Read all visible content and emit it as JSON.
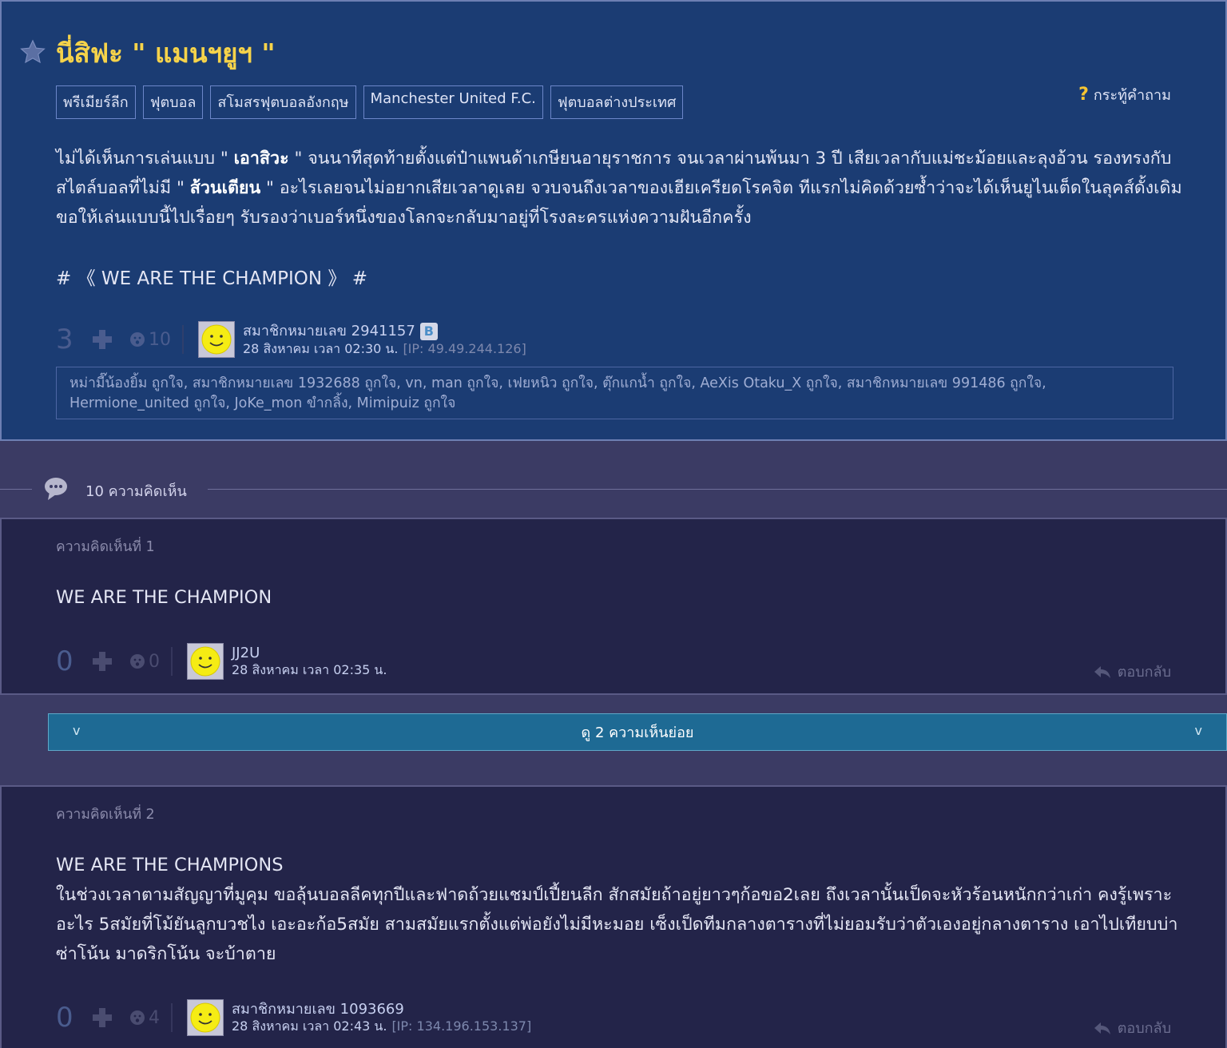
{
  "topic": {
    "title": "นี่สิฟะ \" แมนฯยูฯ \"",
    "tags": [
      "พรีเมียร์ลีก",
      "ฟุตบอล",
      "สโมสรฟุตบอลอังกฤษ",
      "Manchester United F.C.",
      "ฟุตบอลต่างประเทศ"
    ],
    "question_type": "กระทู้คำถาม",
    "body_parts": [
      "ไม่ได้เห็นการเล่นแบบ \" ",
      "เอาสิวะ",
      " \" จนนาทีสุดท้ายตั้งแต่ป๋าแพนด้าเกษียนอายุราชการ จนเวลาผ่านพ้นมา 3 ปี เสียเวลากับแม่ชะม้อยและลุงอ้วน รองทรงกับสไตล์บอลที่ไม่มี \" ",
      "ส้วนเตียน",
      " \" อะไรเลยจนไม่อยากเสียเวลาดูเลย จวบจนถึงเวลาของเฮียเครียดโรคจิต ทีแรกไม่คิดด้วยซ้ำว่าจะได้เห็นยูไนเต็ดในลุคส์ดั้งเดิม ขอให้เล่นแบบนี้ไปเรื่อยๆ รับรองว่าเบอร์หนึ่งของโลกจะกลับมาอยู่ที่โรงละครแห่งความฝันอีกครั้ง"
    ],
    "hashtag": "# 《 WE ARE THE CHAMPION 》 #",
    "votes": "3",
    "emotions": "10",
    "author": "สมาชิกหมายเลข 2941157",
    "badge": "B",
    "date": "28 สิงหาคม เวลา 02:30 น.",
    "ip": "[IP: 49.49.244.126]",
    "likes": "หม่ามี๊น้องยิ้ม ถูกใจ, สมาชิกหมายเลข 1932688 ถูกใจ, vn, man ถูกใจ, เฟยหนิว ถูกใจ, ตุ๊กแกน้ำ ถูกใจ, AeXis Otaku_X ถูกใจ, สมาชิกหมายเลข 991486 ถูกใจ, Hermione_united ถูกใจ, JoKe_mon ขำกลิ้ง, Mimipuiz ถูกใจ"
  },
  "comment_count": "10 ความคิดเห็น",
  "comments": [
    {
      "label": "ความคิดเห็นที่ 1",
      "text": "WE ARE THE CHAMPION",
      "votes": "0",
      "emotions": "0",
      "author": "JJ2U",
      "date": "28 สิงหาคม เวลา 02:35 น.",
      "reply": "ตอบกลับ"
    },
    {
      "label": "ความคิดเห็นที่ 2",
      "text_lines": [
        "WE ARE THE CHAMPIONS",
        "ในช่วงเวลาตามสัญญาที่มูคุม ขอลุ้นบอลลีคทุกปีและฟาดถ้วยแชมป์เปี้ยนลีก สักสมัยถ้าอยู่ยาวๆก้อขอ2เลย ถึงเวลานั้นเป็ดจะหัวร้อนหนักกว่าเก่า คงรู้เพราะอะไร 5สมัยที่โม้ยันลูกบวชไง เอะอะก้อ5สมัย สามสมัยแรกตั้งแต่พ่อยังไม่มีหะมอย เซ็งเป็ดทีมกลางตารางที่ไม่ยอมรับว่าตัวเองอยู่กลางตาราง เอาไปเทียบบ่าซ่าโน้น มาดริกโน้น จะบ้าตาย"
      ],
      "votes": "0",
      "emotions": "4",
      "author": "สมาชิกหมายเลข 1093669",
      "date": "28 สิงหาคม เวลา 02:43 น.",
      "ip": "[IP: 134.196.153.137]",
      "reply": "ตอบกลับ"
    }
  ],
  "sub_comments_bar": {
    "label": "ดู 2 ความเห็นย่อย",
    "chevron": "v"
  },
  "colors": {
    "topic_bg": "#1b3c73",
    "comment_bg": "#232449",
    "page_bg": "#3b3b64",
    "title": "#f6d34a",
    "subbar_bg": "#1e6a94"
  },
  "icons": [
    "star-icon",
    "question-icon",
    "plus-icon",
    "emotion-icon",
    "avatar-smiley-icon",
    "comment-bubble-icon",
    "reply-arrow-icon",
    "chevron-down-icon"
  ]
}
